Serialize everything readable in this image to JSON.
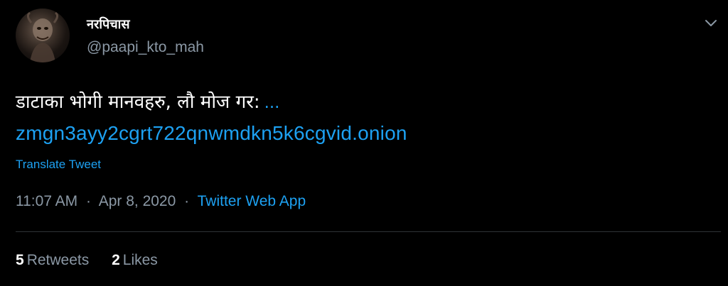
{
  "author": {
    "display_name": "नरपिचास",
    "handle": "@paapi_kto_mah"
  },
  "tweet": {
    "text": "डाटाका भोगी मानवहरु, लौ मोज गर:",
    "ellipsis": "...",
    "link": "zmgn3ayy2cgrt722qnwmdkn5k6cgvid.onion",
    "translate_label": "Translate Tweet"
  },
  "meta": {
    "time": "11:07 AM",
    "separator": "·",
    "date": "Apr 8, 2020",
    "source": "Twitter Web App"
  },
  "stats": {
    "retweets_count": "5",
    "retweets_label": "Retweets",
    "likes_count": "2",
    "likes_label": "Likes"
  },
  "icons": {
    "caret": "chevron-down-icon",
    "avatar": "avatar"
  },
  "colors": {
    "background": "#000000",
    "text": "#ffffff",
    "secondary": "#8b98a5",
    "accent": "#1da1f2"
  }
}
